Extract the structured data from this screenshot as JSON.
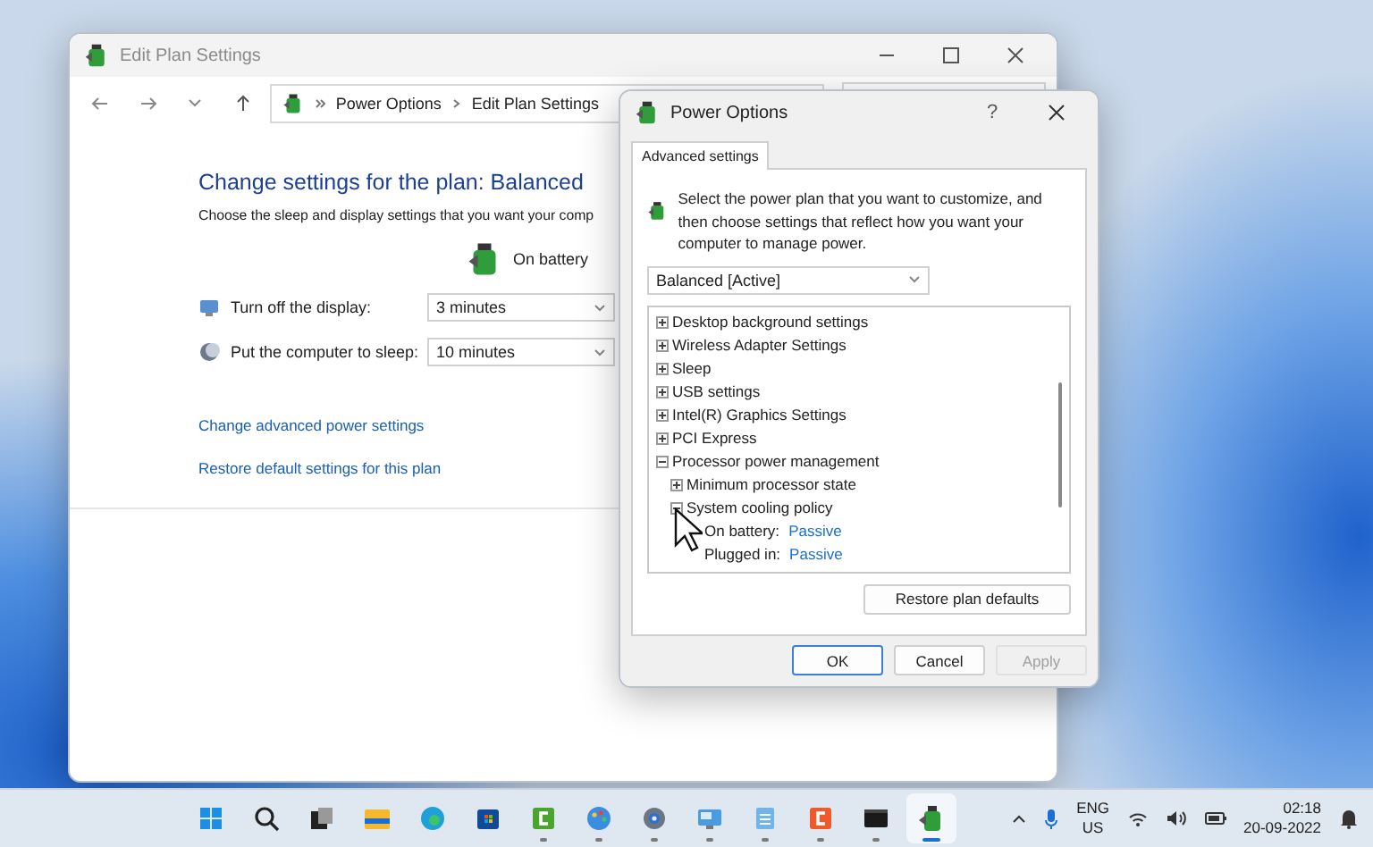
{
  "main_window": {
    "title": "Edit Plan Settings",
    "breadcrumb": [
      "Power Options",
      "Edit Plan Settings"
    ],
    "heading": "Change settings for the plan: Balanced",
    "description": "Choose the sleep and display settings that you want your comp",
    "column": "On battery",
    "settings": [
      {
        "kind": "display",
        "label": "Turn off the display:",
        "value": "3 minutes"
      },
      {
        "kind": "sleep",
        "label": "Put the computer to sleep:",
        "value": "10 minutes"
      }
    ],
    "links": [
      "Change advanced power settings",
      "Restore default settings for this plan"
    ]
  },
  "dialog": {
    "title": "Power Options",
    "help": "?",
    "tabs": [
      {
        "label": "Advanced settings",
        "selected": true
      }
    ],
    "intro": "Select the power plan that you want to customize, and then choose settings that reflect how you want your computer to manage power.",
    "plan": "Balanced [Active]",
    "tree": [
      {
        "label": "Desktop background settings",
        "expanded": false
      },
      {
        "label": "Wireless Adapter Settings",
        "expanded": false
      },
      {
        "label": "Sleep",
        "expanded": false
      },
      {
        "label": "USB settings",
        "expanded": false
      },
      {
        "label": "Intel(R) Graphics Settings",
        "expanded": false
      },
      {
        "label": "PCI Express",
        "expanded": false
      },
      {
        "label": "Processor power management",
        "expanded": true,
        "children": [
          {
            "label": "Minimum processor state",
            "expanded": false
          },
          {
            "label": "System cooling policy",
            "expanded": true,
            "children": [
              {
                "label": "On battery:",
                "value": "Passive"
              },
              {
                "label": "Plugged in:",
                "value": "Passive"
              }
            ]
          }
        ]
      }
    ],
    "restore_button": "Restore plan defaults",
    "buttons": [
      {
        "label": "OK",
        "disabled": false,
        "default": true
      },
      {
        "label": "Cancel",
        "disabled": false,
        "default": false
      },
      {
        "label": "Apply",
        "disabled": true,
        "default": false
      }
    ]
  },
  "taskbar": {
    "apps": [
      {
        "kind": "start",
        "running": false,
        "selected": false
      },
      {
        "kind": "search",
        "running": false,
        "selected": false
      },
      {
        "kind": "taskview",
        "running": false,
        "selected": false
      },
      {
        "kind": "folder",
        "running": false,
        "selected": false
      },
      {
        "kind": "browser",
        "running": false,
        "selected": false
      },
      {
        "kind": "store",
        "running": false,
        "selected": false
      },
      {
        "kind": "green-c",
        "running": true,
        "selected": false
      },
      {
        "kind": "paint",
        "running": true,
        "selected": false
      },
      {
        "kind": "gear",
        "running": true,
        "selected": false
      },
      {
        "kind": "monitor",
        "running": true,
        "selected": false
      },
      {
        "kind": "notepad",
        "running": true,
        "selected": false
      },
      {
        "kind": "orange-c",
        "running": true,
        "selected": false
      },
      {
        "kind": "terminal",
        "running": true,
        "selected": false
      },
      {
        "kind": "power",
        "running": true,
        "selected": true
      }
    ],
    "language": [
      "ENG",
      "US"
    ],
    "time": "02:18",
    "date": "20-09-2022"
  }
}
